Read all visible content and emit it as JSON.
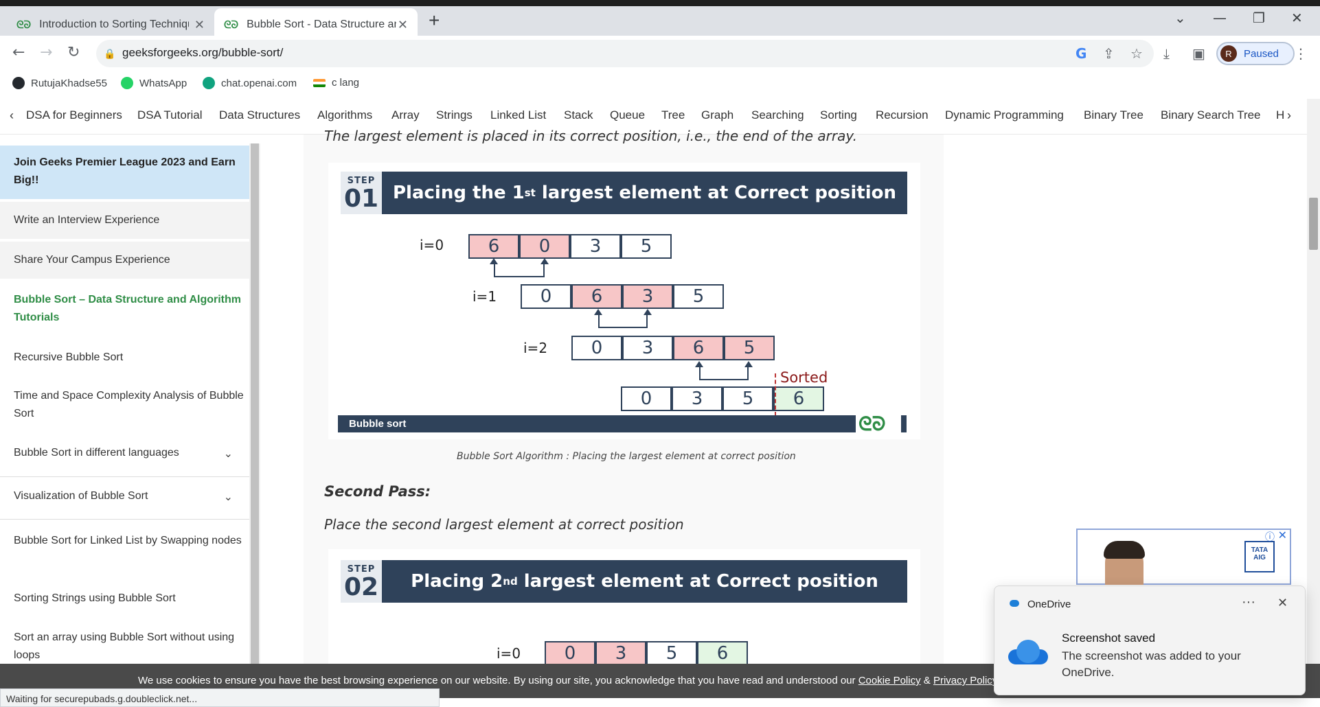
{
  "browser": {
    "tabs": [
      {
        "title": "Introduction to Sorting Techniques"
      },
      {
        "title": "Bubble Sort - Data Structure and Algorithm Tutorials"
      }
    ],
    "url": "geeksforgeeks.org/bubble-sort/",
    "profile": {
      "initial": "R",
      "status": "Paused"
    },
    "bookmarks": [
      {
        "label": "RutujaKhadse55",
        "icon": "github-icon",
        "color": "#24292e"
      },
      {
        "label": "WhatsApp",
        "icon": "whatsapp-icon",
        "color": "#25d366"
      },
      {
        "label": "chat.openai.com",
        "icon": "openai-icon",
        "color": "#10a37f"
      },
      {
        "label": "c lang",
        "icon": "india-flag-icon",
        "color": "#ff9933"
      }
    ]
  },
  "nav": {
    "items": [
      "DSA for Beginners",
      "DSA Tutorial",
      "Data Structures",
      "Algorithms",
      "Array",
      "Strings",
      "Linked List",
      "Stack",
      "Queue",
      "Tree",
      "Graph",
      "Searching",
      "Sorting",
      "Recursion",
      "Dynamic Programming",
      "Binary Tree",
      "Binary Search Tree",
      "H"
    ]
  },
  "sidebar": {
    "items": [
      {
        "label": "Join Geeks Premier League 2023 and Earn Big!!"
      },
      {
        "label": "Write an Interview Experience"
      },
      {
        "label": "Share Your Campus Experience"
      },
      {
        "label": "Bubble Sort – Data Structure and Algorithm Tutorials"
      },
      {
        "label": "Recursive Bubble Sort"
      },
      {
        "label": "Time and Space Complexity Analysis of Bubble Sort"
      },
      {
        "label": "Bubble Sort in different languages"
      },
      {
        "label": "Visualization of Bubble Sort"
      },
      {
        "label": "Bubble Sort for Linked List by Swapping nodes"
      },
      {
        "label": "Sorting Strings using Bubble Sort"
      },
      {
        "label": "Sort an array using Bubble Sort without using loops"
      }
    ]
  },
  "article": {
    "intro": "The largest element is placed in its correct position, i.e., the end of the array.",
    "step1": {
      "step_word": "STEP",
      "step_num": "01",
      "title_pre": "Placing the 1",
      "title_sup": "st",
      "title_post": " largest element at Correct position",
      "rows": [
        {
          "label": "i=0",
          "cells": [
            "6",
            "0",
            "3",
            "5"
          ]
        },
        {
          "label": "i=1",
          "cells": [
            "0",
            "6",
            "3",
            "5"
          ]
        },
        {
          "label": "i=2",
          "cells": [
            "0",
            "3",
            "6",
            "5"
          ]
        },
        {
          "label": "",
          "cells": [
            "0",
            "3",
            "5",
            "6"
          ]
        }
      ],
      "sorted_label": "Sorted",
      "footer": "Bubble sort",
      "logo": "GfG",
      "caption": "Bubble Sort Algorithm : Placing the largest element at correct position"
    },
    "second_pass_heading": "Second Pass:",
    "second_pass_text": "Place the second largest element at correct position",
    "step2": {
      "step_word": "STEP",
      "step_num": "02",
      "title_pre": "Placing 2",
      "title_sup": "nd",
      "title_post": " largest element at Correct position",
      "rows": [
        {
          "label": "i=0",
          "cells": [
            "0",
            "3",
            "5",
            "6"
          ]
        }
      ]
    },
    "colors": {
      "swap": "#f7c6c7",
      "sorted": "#e3f6e3",
      "banner": "#2f425a",
      "brand": "#2f8d46"
    }
  },
  "ad": {
    "brand": "TATA AIG"
  },
  "cookie": {
    "text": "We use cookies to ensure you have the best browsing experience on our website. By using our site, you acknowledge that you have read and understood our ",
    "cookie_policy": "Cookie Policy",
    "amp": " & ",
    "privacy_policy": "Privacy Policy"
  },
  "status": "Waiting for securepubads.g.doubleclick.net...",
  "toast": {
    "app": "OneDrive",
    "title": "Screenshot saved",
    "body": "The screenshot was added to your OneDrive."
  }
}
